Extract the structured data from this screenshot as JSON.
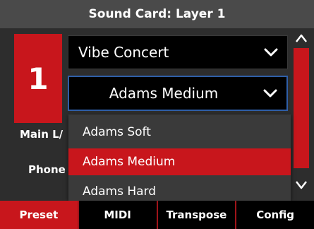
{
  "title": "Sound Card: Layer 1",
  "layer": {
    "number": "1"
  },
  "preset_select": {
    "value": "Vibe Concert"
  },
  "variant_select": {
    "value": "Adams Medium"
  },
  "rows": {
    "main_label": "Main L/",
    "phone_label": "Phone"
  },
  "dropdown": {
    "options": [
      "Adams Soft",
      "Adams Medium",
      "Adams Hard"
    ],
    "selected_index": 1
  },
  "tabs": [
    "Preset",
    "MIDI",
    "Transpose",
    "Config"
  ],
  "active_tab": 0,
  "colors": {
    "accent": "#c8161c",
    "focus": "#2f5fa8",
    "title_bg": "#4a4a4a"
  },
  "icons": {
    "select_chevron": "chevron-down-icon",
    "scroll_up": "scroll-up-icon",
    "scroll_down": "scroll-down-icon"
  }
}
